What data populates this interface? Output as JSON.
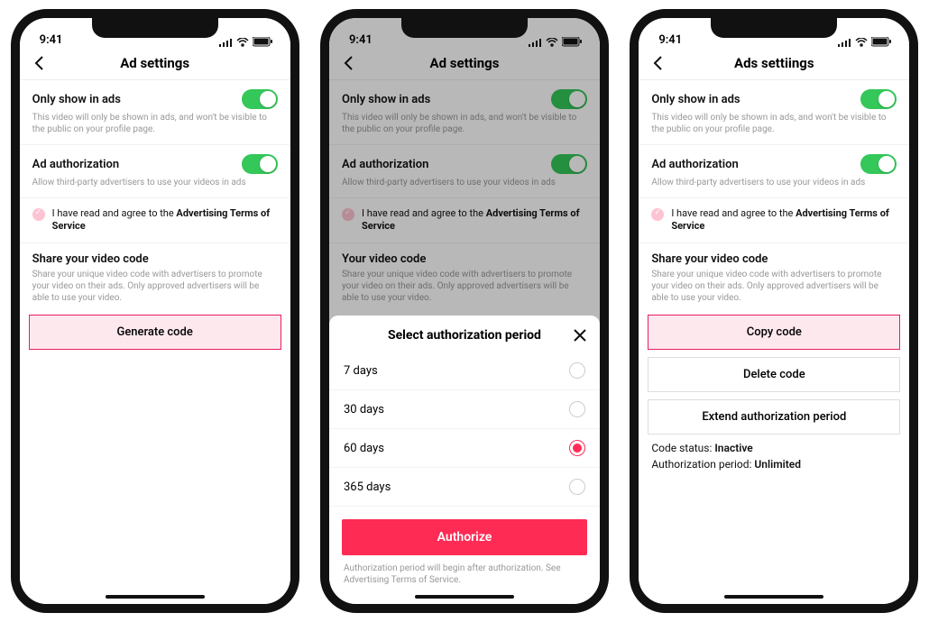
{
  "status": {
    "time": "9:41"
  },
  "phone1": {
    "title": "Ad settings",
    "onlyShow": {
      "title": "Only show in ads",
      "sub": "This video will only be shown in ads, and won't be visible to the public on your profile page."
    },
    "adAuth": {
      "title": "Ad authorization",
      "sub": "Allow third-party advertisers to use your videos in ads"
    },
    "terms": {
      "prefix": "I have read and agree to the ",
      "link": "Advertising Terms of Service"
    },
    "share": {
      "title": "Share your video code",
      "sub": "Share your unique video code with advertisers to promote your video on their ads. Only approved advertisers will be able to use your video."
    },
    "generateBtn": "Generate code"
  },
  "phone2": {
    "title": "Ad settings",
    "shareTitle": "Your video code",
    "sheet": {
      "title": "Select authorization period",
      "options": [
        "7 days",
        "30 days",
        "60 days",
        "365 days"
      ],
      "selectedIndex": 2,
      "authorizeBtn": "Authorize",
      "footnote": "Authorization period will begin after authorization. See Advertising Terms of Service."
    }
  },
  "phone3": {
    "title": "Ads settiings",
    "copyBtn": "Copy code",
    "deleteBtn": "Delete code",
    "extendBtn": "Extend authorization period",
    "codeStatusLabel": "Code status: ",
    "codeStatusValue": "Inactive",
    "authPeriodLabel": "Authorization period: ",
    "authPeriodValue": "Unlimited"
  }
}
